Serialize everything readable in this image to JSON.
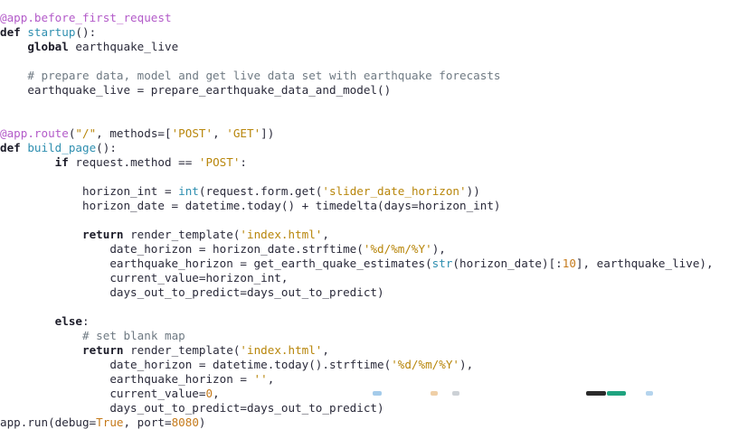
{
  "editor": {
    "lines": [
      [
        {
          "t": "deco",
          "v": "@app.before_first_request"
        }
      ],
      [
        {
          "t": "kw",
          "v": "def"
        },
        {
          "t": "tx",
          "v": " "
        },
        {
          "t": "fn",
          "v": "startup"
        },
        {
          "t": "tx",
          "v": "():"
        }
      ],
      [
        {
          "t": "tx",
          "v": "    "
        },
        {
          "t": "kw",
          "v": "global"
        },
        {
          "t": "tx",
          "v": " earthquake_live"
        }
      ],
      [],
      [
        {
          "t": "tx",
          "v": "    "
        },
        {
          "t": "cm",
          "v": "# prepare data, model and get live data set with earthquake forecasts"
        }
      ],
      [
        {
          "t": "tx",
          "v": "    earthquake_live = prepare_earthquake_data_and_model()"
        }
      ],
      [],
      [],
      [
        {
          "t": "deco",
          "v": "@app.route"
        },
        {
          "t": "tx",
          "v": "("
        },
        {
          "t": "st",
          "v": "\"/\""
        },
        {
          "t": "tx",
          "v": ", methods=["
        },
        {
          "t": "st",
          "v": "'POST'"
        },
        {
          "t": "tx",
          "v": ", "
        },
        {
          "t": "st",
          "v": "'GET'"
        },
        {
          "t": "tx",
          "v": "])"
        }
      ],
      [
        {
          "t": "kw",
          "v": "def"
        },
        {
          "t": "tx",
          "v": " "
        },
        {
          "t": "fn",
          "v": "build_page"
        },
        {
          "t": "tx",
          "v": "():"
        }
      ],
      [
        {
          "t": "tx",
          "v": "        "
        },
        {
          "t": "kw",
          "v": "if"
        },
        {
          "t": "tx",
          "v": " request.method == "
        },
        {
          "t": "st",
          "v": "'POST'"
        },
        {
          "t": "tx",
          "v": ":"
        }
      ],
      [],
      [
        {
          "t": "tx",
          "v": "            horizon_int = "
        },
        {
          "t": "bi",
          "v": "int"
        },
        {
          "t": "tx",
          "v": "(request.form.get("
        },
        {
          "t": "st",
          "v": "'slider_date_horizon'"
        },
        {
          "t": "tx",
          "v": "))"
        }
      ],
      [
        {
          "t": "tx",
          "v": "            horizon_date = datetime.today() + timedelta(days=horizon_int)"
        }
      ],
      [],
      [
        {
          "t": "tx",
          "v": "            "
        },
        {
          "t": "kw",
          "v": "return"
        },
        {
          "t": "tx",
          "v": " render_template("
        },
        {
          "t": "st",
          "v": "'index.html'"
        },
        {
          "t": "tx",
          "v": ","
        }
      ],
      [
        {
          "t": "tx",
          "v": "                date_horizon = horizon_date.strftime("
        },
        {
          "t": "st",
          "v": "'%d/%m/%Y'"
        },
        {
          "t": "tx",
          "v": "),"
        }
      ],
      [
        {
          "t": "tx",
          "v": "                earthquake_horizon = get_earth_quake_estimates("
        },
        {
          "t": "bi",
          "v": "str"
        },
        {
          "t": "tx",
          "v": "(horizon_date)[:"
        },
        {
          "t": "nm",
          "v": "10"
        },
        {
          "t": "tx",
          "v": "], earthquake_live),"
        }
      ],
      [
        {
          "t": "tx",
          "v": "                current_value=horizon_int,"
        }
      ],
      [
        {
          "t": "tx",
          "v": "                days_out_to_predict=days_out_to_predict)"
        }
      ],
      [],
      [
        {
          "t": "tx",
          "v": "        "
        },
        {
          "t": "kw",
          "v": "else"
        },
        {
          "t": "tx",
          "v": ":"
        }
      ],
      [
        {
          "t": "tx",
          "v": "            "
        },
        {
          "t": "cm",
          "v": "# set blank map"
        }
      ],
      [
        {
          "t": "tx",
          "v": "            "
        },
        {
          "t": "kw",
          "v": "return"
        },
        {
          "t": "tx",
          "v": " render_template("
        },
        {
          "t": "st",
          "v": "'index.html'"
        },
        {
          "t": "tx",
          "v": ","
        }
      ],
      [
        {
          "t": "tx",
          "v": "                date_horizon = datetime.today().strftime("
        },
        {
          "t": "st",
          "v": "'%d/%m/%Y'"
        },
        {
          "t": "tx",
          "v": "),"
        }
      ],
      [
        {
          "t": "tx",
          "v": "                earthquake_horizon = "
        },
        {
          "t": "st",
          "v": "''"
        },
        {
          "t": "tx",
          "v": ","
        }
      ],
      [
        {
          "t": "tx",
          "v": "                current_value="
        },
        {
          "t": "nm",
          "v": "0"
        },
        {
          "t": "tx",
          "v": ","
        }
      ],
      [
        {
          "t": "tx",
          "v": "                days_out_to_predict=days_out_to_predict)"
        }
      ],
      [
        {
          "t": "tx",
          "v": "app.run(debug="
        },
        {
          "t": "cn",
          "v": "True"
        },
        {
          "t": "tx",
          "v": ", port="
        },
        {
          "t": "nm",
          "v": "8080"
        },
        {
          "t": "tx",
          "v": ")"
        }
      ]
    ]
  }
}
